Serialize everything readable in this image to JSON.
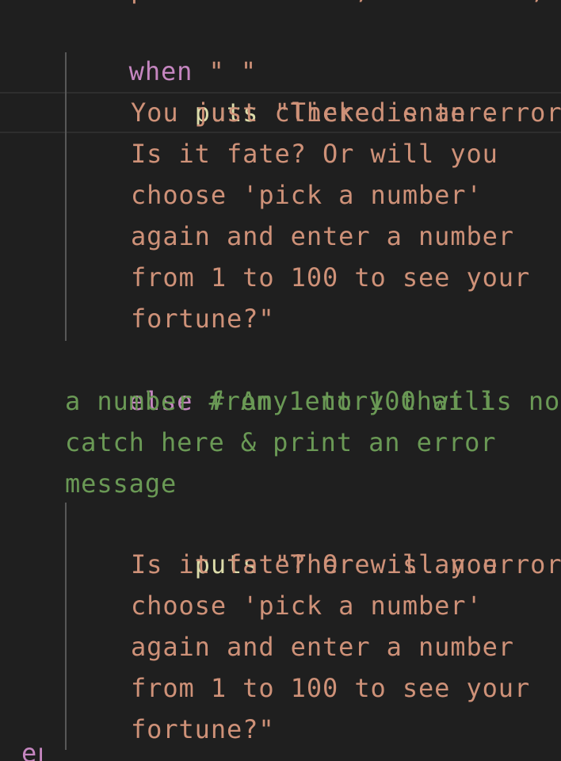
{
  "editor": {
    "cut_top_fragment": "p             ,          ;",
    "when_keyword": "when",
    "when_value": "\" \"",
    "puts_keyword": "puts",
    "error_one": [
      "\"There is an error.",
      "You just clicked enter.",
      "Is it fate? Or will you",
      "choose 'pick a number'",
      "again and enter a number",
      "from 1 to 100 to see your",
      "fortune?\""
    ],
    "else_keyword": "else",
    "else_comment": [
      "# Any entry that is not",
      "a number from 1 to 100 will",
      "catch here & print an error",
      "message"
    ],
    "error_two": [
      "\"There is an error.",
      "Is it fate? Or will you",
      "choose 'pick a number'",
      "again and enter a number",
      "from 1 to 100 to see your",
      "fortune?\""
    ],
    "cut_bottom_keyword": "end"
  },
  "colors": {
    "background": "#1f1f1f",
    "keyword": "#c586c0",
    "string": "#ce9178",
    "function": "#dcdcaa",
    "comment": "#6a9955",
    "indent_guide": "#585858"
  }
}
